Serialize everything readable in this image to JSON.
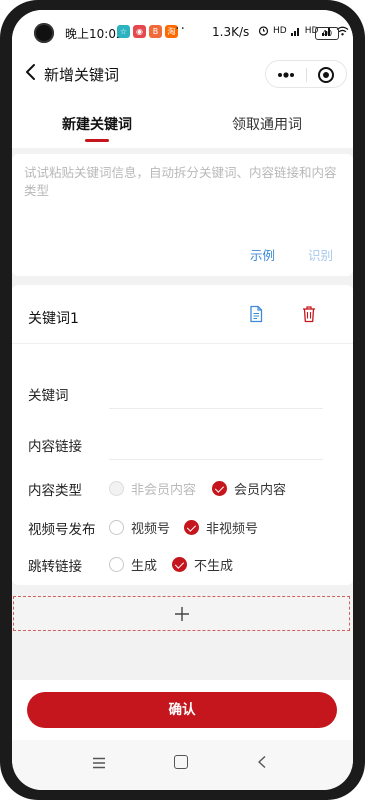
{
  "status_bar": {
    "time": "晚上10:02",
    "app_badges": [
      {
        "text": "☆",
        "color": "#2bb3c0"
      },
      {
        "text": "◉",
        "color": "#e5484d"
      },
      {
        "text": "B",
        "color": "#ef6b3a"
      },
      {
        "text": "淘",
        "color": "#ff6a00"
      }
    ],
    "more": "··",
    "network_speed": "1.3K/s",
    "signal_labels": [
      "HD",
      "HD"
    ],
    "battery": "40"
  },
  "nav": {
    "title": "新增关键词"
  },
  "tabs": [
    {
      "label": "新建关键词",
      "active": true
    },
    {
      "label": "领取通用词",
      "active": false
    }
  ],
  "paste": {
    "placeholder": "试试粘贴关键词信息，自动拆分关键词、内容链接和内容类型",
    "example_label": "示例",
    "recognize_label": "识别"
  },
  "keyword_card": {
    "title": "关键词1",
    "keyword_label": "关键词",
    "keyword_value": "",
    "link_label": "内容链接",
    "link_value": "",
    "content_type_label": "内容类型",
    "content_type_options": [
      {
        "label": "非会员内容",
        "state": "disabled"
      },
      {
        "label": "会员内容",
        "state": "checked"
      }
    ],
    "video_label": "视频号发布",
    "video_options": [
      {
        "label": "视频号",
        "state": "unchecked"
      },
      {
        "label": "非视频号",
        "state": "checked"
      }
    ],
    "jump_label": "跳转链接",
    "jump_options": [
      {
        "label": "生成",
        "state": "unchecked"
      },
      {
        "label": "不生成",
        "state": "checked"
      }
    ]
  },
  "actions": {
    "confirm_label": "确认"
  },
  "colors": {
    "accent": "#c4161c",
    "link_blue": "#3d8ad8",
    "link_blue_disabled": "#a7c8ec"
  }
}
